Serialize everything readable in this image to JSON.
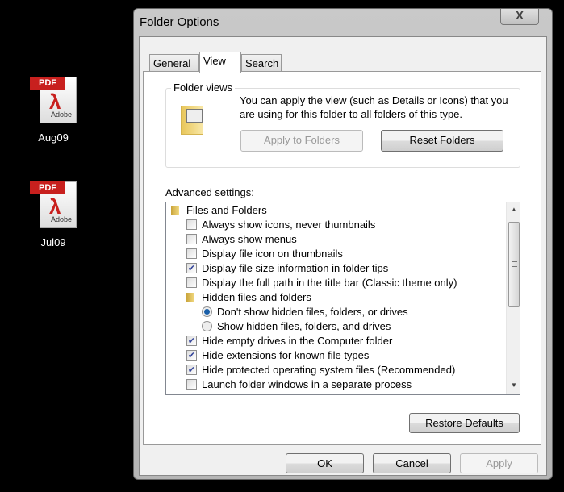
{
  "desktop": [
    {
      "label": "Aug09",
      "icon": "pdf-file-icon",
      "tag": "PDF",
      "brand": "Adobe"
    },
    {
      "label": "Jul09",
      "icon": "pdf-file-icon",
      "tag": "PDF",
      "brand": "Adobe"
    }
  ],
  "dialog": {
    "title": "Folder Options",
    "close": "X",
    "tabs": [
      {
        "label": "General"
      },
      {
        "label": "View",
        "selected": true
      },
      {
        "label": "Search"
      }
    ],
    "folder_views": {
      "label": "Folder views",
      "desc1": "You can apply the view (such as Details or Icons) that you",
      "desc2": "are using for this folder to all folders of this type.",
      "apply_label": "Apply to Folders",
      "reset_label": "Reset Folders"
    },
    "advanced_label": "Advanced settings:",
    "items": [
      {
        "type": "folder",
        "level": 0,
        "label": "Files and Folders"
      },
      {
        "type": "checkbox",
        "level": 1,
        "checked": false,
        "label": "Always show icons, never thumbnails"
      },
      {
        "type": "checkbox",
        "level": 1,
        "checked": false,
        "label": "Always show menus"
      },
      {
        "type": "checkbox",
        "level": 1,
        "checked": false,
        "label": "Display file icon on thumbnails"
      },
      {
        "type": "checkbox",
        "level": 1,
        "checked": true,
        "label": "Display file size information in folder tips"
      },
      {
        "type": "checkbox",
        "level": 1,
        "checked": false,
        "label": "Display the full path in the title bar (Classic theme only)"
      },
      {
        "type": "folder",
        "level": 1,
        "label": "Hidden files and folders"
      },
      {
        "type": "radio",
        "level": 2,
        "checked": true,
        "label": "Don't show hidden files, folders, or drives"
      },
      {
        "type": "radio",
        "level": 2,
        "checked": false,
        "label": "Show hidden files, folders, and drives"
      },
      {
        "type": "checkbox",
        "level": 1,
        "checked": true,
        "label": "Hide empty drives in the Computer folder"
      },
      {
        "type": "checkbox",
        "level": 1,
        "checked": true,
        "label": "Hide extensions for known file types"
      },
      {
        "type": "checkbox",
        "level": 1,
        "checked": true,
        "label": "Hide protected operating system files (Recommended)"
      },
      {
        "type": "checkbox",
        "level": 1,
        "checked": false,
        "label": "Launch folder windows in a separate process"
      }
    ],
    "restore_label": "Restore Defaults",
    "ok_label": "OK",
    "cancel_label": "Cancel",
    "apply_label": "Apply"
  }
}
